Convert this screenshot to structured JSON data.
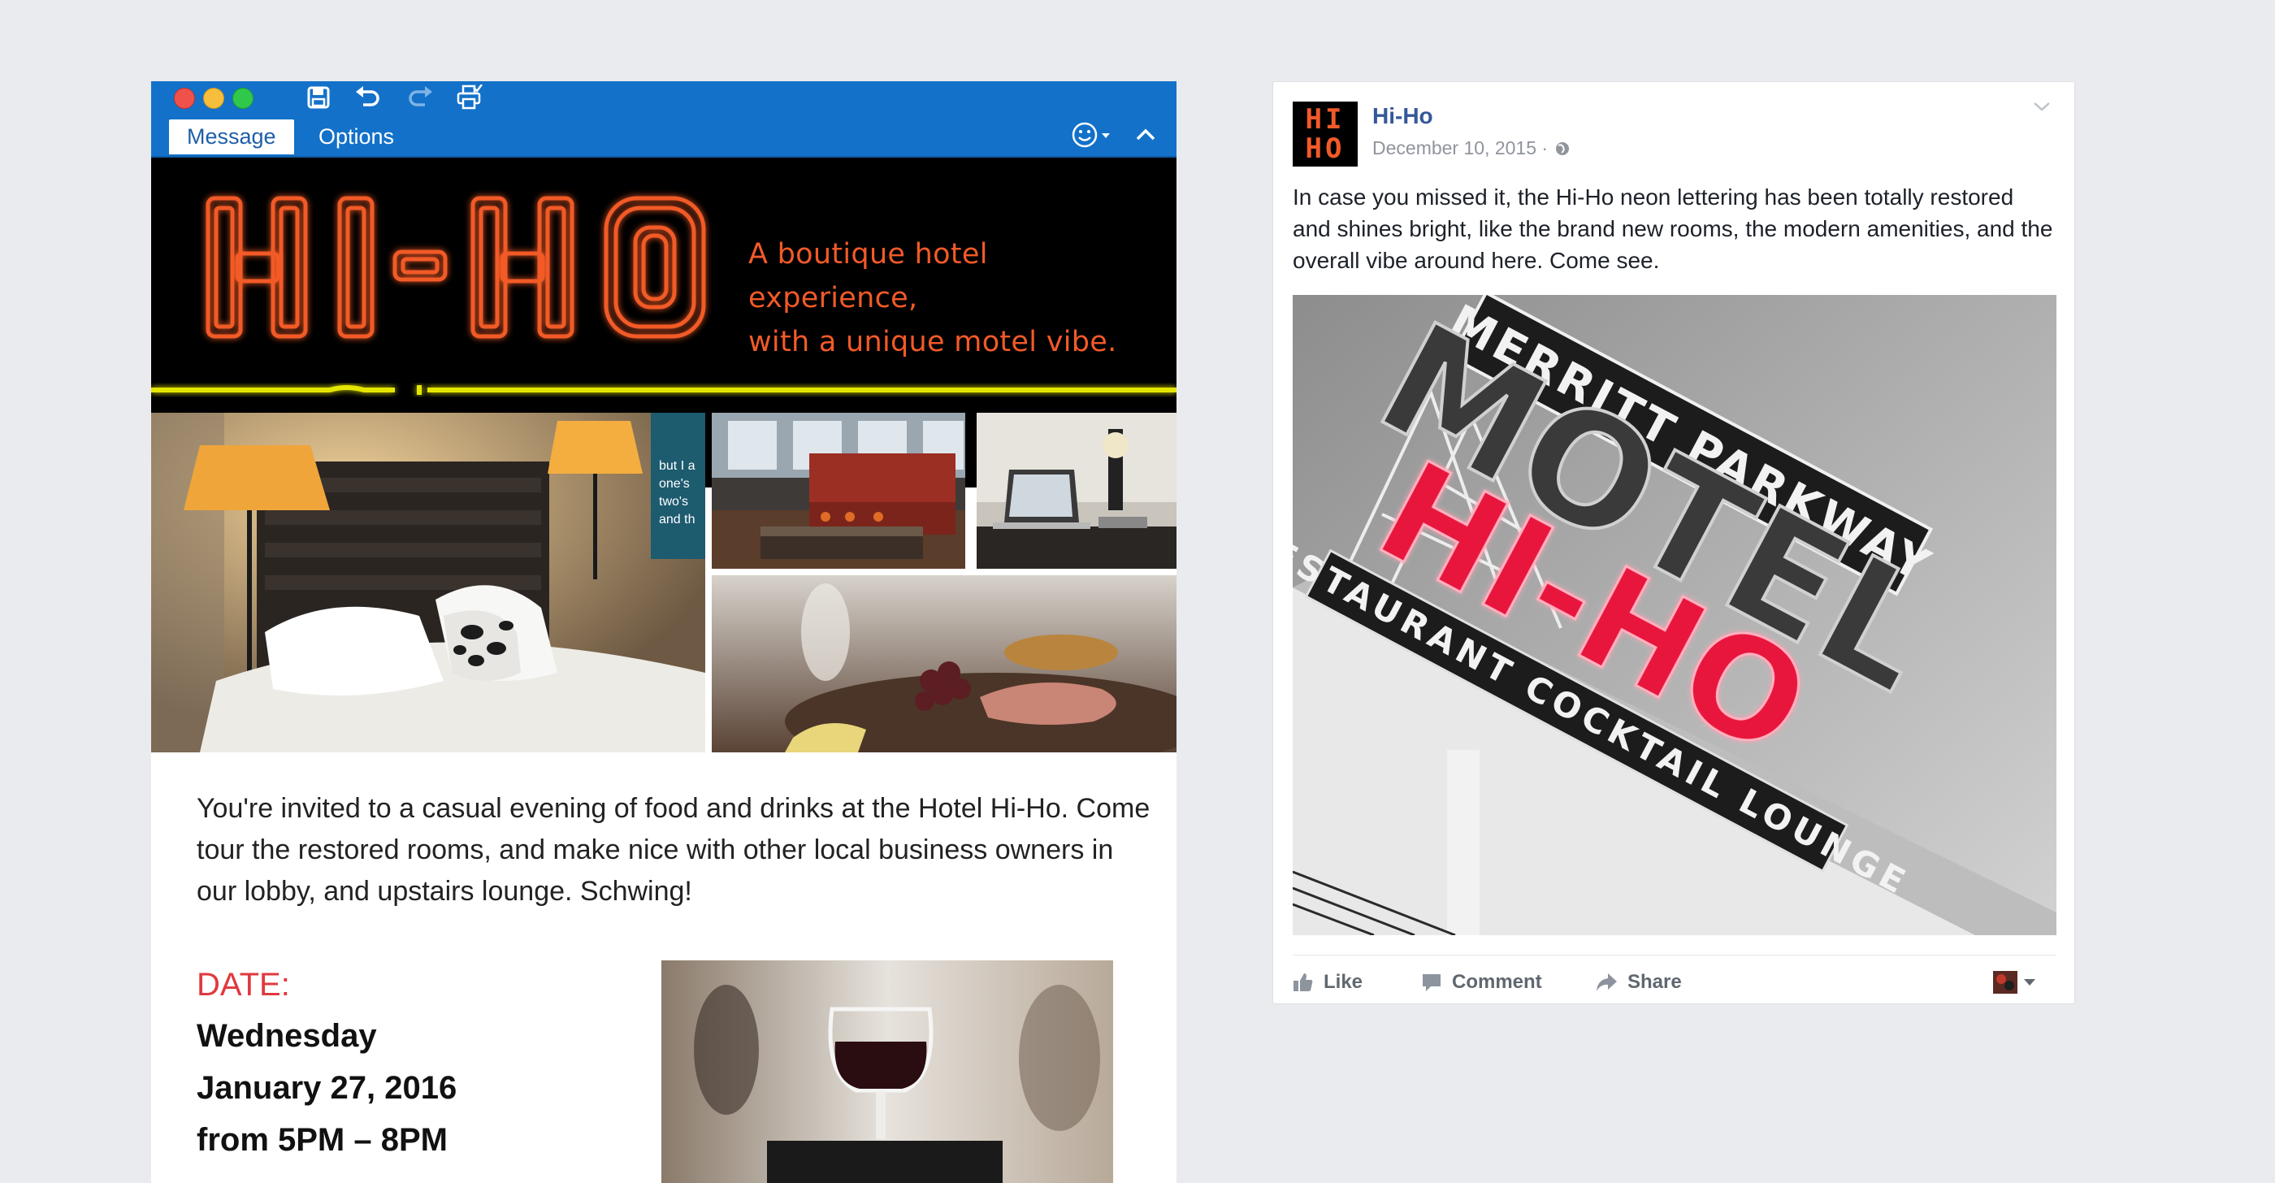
{
  "email": {
    "tabs": [
      {
        "label": "Message"
      },
      {
        "label": "Options"
      }
    ],
    "banner": {
      "logo_text": "HI-HO",
      "tagline_line1": "A boutique hotel experience,",
      "tagline_line2": "with a unique motel vibe."
    },
    "poster_text": [
      "but I a",
      "one's",
      "two's",
      "and th"
    ],
    "invite_text": "You're invited to a casual evening of food and drinks at the Hotel Hi-Ho. Come tour the restored rooms, and make nice with other local business owners in our lobby, and upstairs lounge. Schwing!",
    "date_label": "DATE:",
    "date_lines": [
      "Wednesday",
      "January 27, 2016",
      "from 5PM – 8PM"
    ]
  },
  "post": {
    "page_name": "Hi-Ho",
    "avatar_text": [
      "HI",
      "HO"
    ],
    "date": "December 10, 2015 ·",
    "text": "In case you missed it, the Hi-Ho neon lettering has been totally restored and shines bright, like the brand new rooms, the modern amenities, and the overall vibe around here. Come see.",
    "sign_text": {
      "top": "MERRITT PARKWAY",
      "middle": "MOTEL",
      "neon": "HI-HO",
      "bottom": "RESTAURANT  COCKTAIL LOUNGE"
    },
    "actions": [
      {
        "label": "Like",
        "icon": "thumbs-up-icon"
      },
      {
        "label": "Comment",
        "icon": "comment-icon"
      },
      {
        "label": "Share",
        "icon": "share-icon"
      }
    ]
  },
  "colors": {
    "outlook_blue": "#1371c9",
    "neon_orange": "#f25a28",
    "neon_yellow": "#e5e600",
    "facebook_link": "#365899",
    "date_red": "#e0393e",
    "neon_pink": "#e8183c"
  }
}
